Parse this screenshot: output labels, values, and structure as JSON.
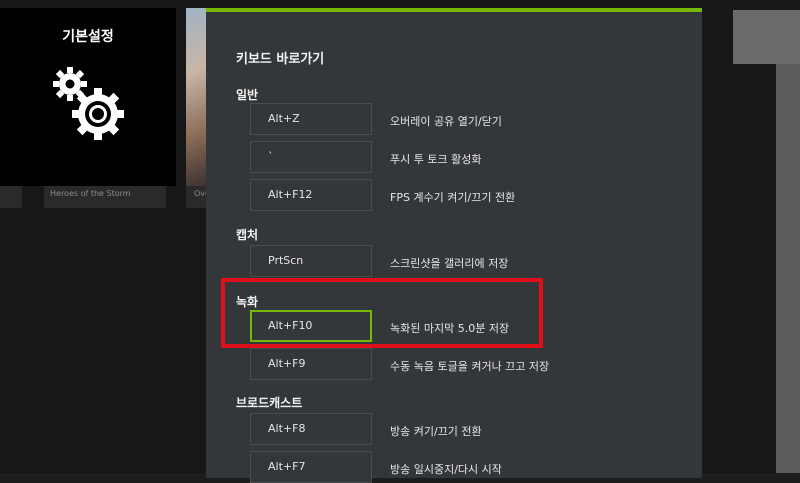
{
  "background": {
    "settings_title": "기본설정",
    "cards": [
      "Heroes of the Storm",
      "Ove"
    ]
  },
  "dialog": {
    "title": "키보드 바로가기",
    "sections": [
      {
        "label": "일반",
        "items": [
          {
            "key": "Alt+Z",
            "desc": "오버레이 공유 열기/닫기"
          },
          {
            "key": "`",
            "desc": "푸시 투 토크 활성화"
          },
          {
            "key": "Alt+F12",
            "desc": "FPS 계수기 켜기/끄기 전환"
          }
        ]
      },
      {
        "label": "캡처",
        "items": [
          {
            "key": "PrtScn",
            "desc": "스크린샷을 갤러리에 저장"
          }
        ]
      },
      {
        "label": "녹화",
        "items": [
          {
            "key": "Alt+F10",
            "desc": "녹화된 마지막 5.0분 저장"
          },
          {
            "key": "Alt+F9",
            "desc": "수동 녹음 토글을 켜거나 끄고 저장"
          }
        ]
      },
      {
        "label": "브로드캐스트",
        "items": [
          {
            "key": "Alt+F8",
            "desc": "방송 켜기/끄기 전환"
          },
          {
            "key": "Alt+F7",
            "desc": "방송 일시중지/다시 시작"
          }
        ]
      }
    ]
  },
  "colors": {
    "accent": "#76b900",
    "highlight": "#e0101a",
    "dialog_bg": "#34373a"
  }
}
